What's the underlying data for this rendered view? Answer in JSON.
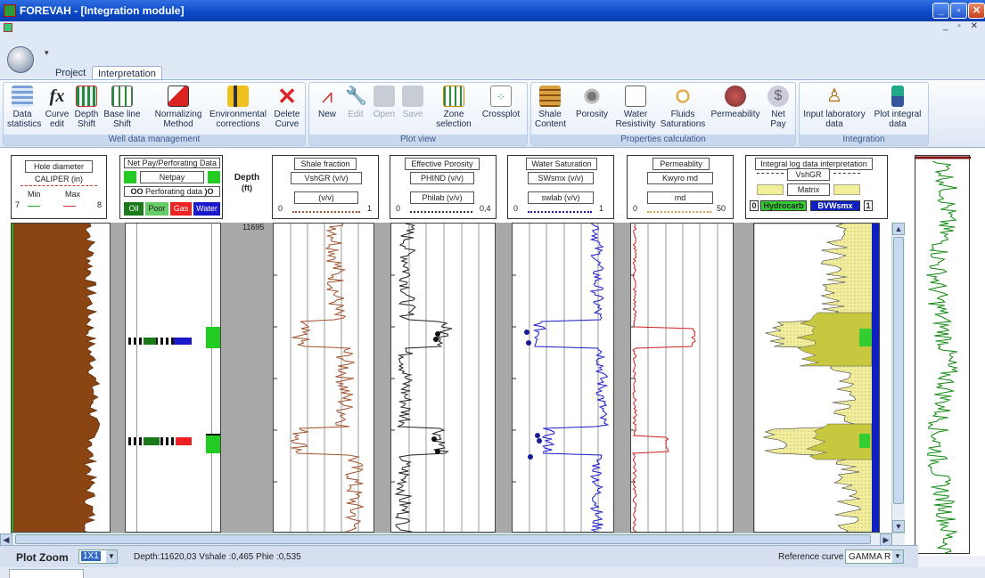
{
  "window": {
    "title": "FOREVAH - [Integration module]"
  },
  "tabs": [
    "Project",
    "Interpretation"
  ],
  "ribbon": {
    "groups": [
      {
        "label": "Well data management",
        "buttons": [
          "Data statistics",
          "Curve edit",
          "Depth Shift",
          "Base line Shift",
          "Normalizing Method",
          "Environmental corrections",
          "Delete Curve"
        ]
      },
      {
        "label": "Plot view",
        "buttons": [
          "New",
          "Edit",
          "Open",
          "Save",
          "Zone selection",
          "Crossplot"
        ]
      },
      {
        "label": "Properties calculation",
        "buttons": [
          "Shale Content",
          "Porosity",
          "Water Resistivity",
          "Fluids Saturations",
          "Permeability",
          "Net Pay"
        ]
      },
      {
        "label": "Integration",
        "buttons": [
          "Input laboratory data",
          "Plot integral data"
        ]
      }
    ]
  },
  "headers": {
    "caliper": {
      "title": "Hole diameter",
      "curve": "CALIPER (in)",
      "min_label": "Min",
      "max_label": "Max",
      "min": "7",
      "max": "8"
    },
    "netpay": {
      "title": "Net Pay/Perforating Data",
      "netpay": "Netpay",
      "perf": "Perforating data",
      "legend": [
        "Oil",
        "Poor",
        "Gas",
        "Water"
      ]
    },
    "depth": {
      "label": "Depth",
      "unit": "(ft)",
      "top_value": "11695"
    },
    "shale": {
      "title": "Shale fraction",
      "curve": "VshGR (v/v)",
      "unit": "(v/v)",
      "min": "0",
      "max": "1"
    },
    "porosity": {
      "title": "Effective Porosity",
      "curve1": "PHIND (v/v)",
      "curve2": "Philab (v/v)",
      "min": "0",
      "max": "0,4"
    },
    "saturation": {
      "title": "Water Saturation",
      "curve1": "SWsmx (v/v)",
      "curve2": "swlab (v/v)",
      "min": "0",
      "max": "1"
    },
    "permeability": {
      "title": "Permeablity",
      "curve1": "Kwyro md",
      "curve2": "md",
      "min": "0",
      "max": "50"
    },
    "integral": {
      "title": "Integral log data interpretation",
      "vsh": "VshGR",
      "matrix": "Matrix",
      "left_num": "0",
      "hydro": "Hydrocarb",
      "bvw": "BVWsmx",
      "right_num": "1"
    }
  },
  "status": {
    "zoom_label": "Plot Zoom",
    "zoom_value": "1X1",
    "readout": "Depth:11620,03 Vshale :0,465 Phie :0,535",
    "ref_label": "Reference curve",
    "ref_value": "GAMMA R"
  },
  "colors": {
    "caliper_fill": "#8b4513",
    "shale": "#a0522d",
    "porosity": "#222222",
    "saturation": "#1a1acc",
    "perm": "#cc2222",
    "integral_fill": "#f2ee9a",
    "bvw": "#1020c0",
    "hydro": "#33cc33",
    "gamma": "#118811"
  }
}
